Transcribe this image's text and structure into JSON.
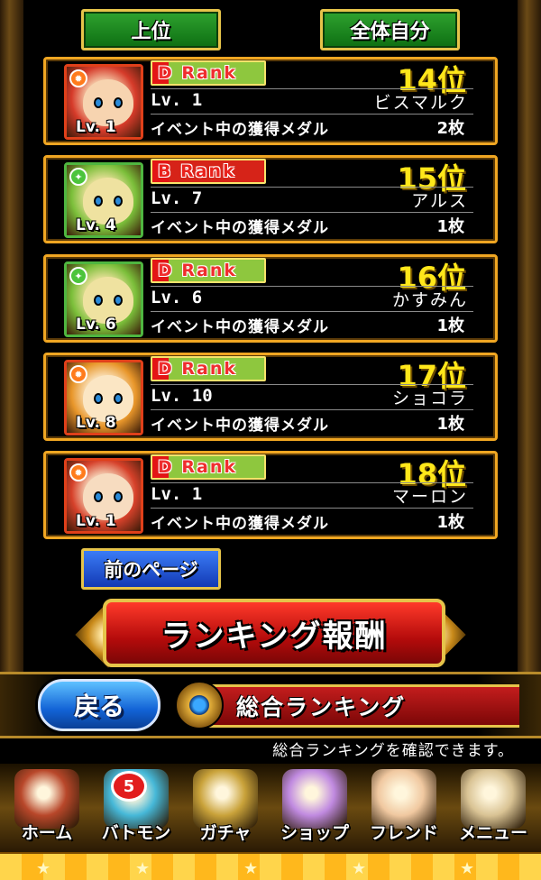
{
  "top_buttons": {
    "top": "上位",
    "self": "全体自分"
  },
  "entries": [
    {
      "rank_badge": "D Rank",
      "rank_class": "D",
      "place": "14位",
      "level": "Lv.  1",
      "name": "ビスマルク",
      "medal_label": "イベント中の獲得メダル",
      "medals": "2枚",
      "avatar_level": "Lv. 1",
      "element": "fire",
      "avatar_colors": [
        "#d63b2a",
        "#f7d4b0"
      ]
    },
    {
      "rank_badge": "B Rank",
      "rank_class": "B",
      "place": "15位",
      "level": "Lv.  7",
      "name": "アルス",
      "medal_label": "イベント中の獲得メダル",
      "medals": "1枚",
      "avatar_level": "Lv. 4",
      "element": "wind",
      "avatar_colors": [
        "#7bbf3a",
        "#efe2a0"
      ]
    },
    {
      "rank_badge": "D Rank",
      "rank_class": "D",
      "place": "16位",
      "level": "Lv.  6",
      "name": "かすみん",
      "medal_label": "イベント中の獲得メダル",
      "medals": "1枚",
      "avatar_level": "Lv. 6",
      "element": "wind",
      "avatar_colors": [
        "#7bbf3a",
        "#efe2a0"
      ]
    },
    {
      "rank_badge": "D Rank",
      "rank_class": "D",
      "place": "17位",
      "level": "Lv. 10",
      "name": "ショコラ",
      "medal_label": "イベント中の獲得メダル",
      "medals": "1枚",
      "avatar_level": "Lv. 8",
      "element": "fire",
      "avatar_colors": [
        "#e8962a",
        "#fbe6c4"
      ]
    },
    {
      "rank_badge": "D Rank",
      "rank_class": "D",
      "place": "18位",
      "level": "Lv.  1",
      "name": "マーロン",
      "medal_label": "イベント中の獲得メダル",
      "medals": "1枚",
      "avatar_level": "Lv. 1",
      "element": "fire",
      "avatar_colors": [
        "#d6412a",
        "#f7dcc0"
      ]
    }
  ],
  "prev_page": "前のページ",
  "reward_button": "ランキング報酬",
  "back_button": "戻る",
  "screen_title": "総合ランキング",
  "info_text": "総合ランキングを確認できます。",
  "menu": [
    {
      "label": "ホーム",
      "icon": "home-icon",
      "color": "#b8472a"
    },
    {
      "label": "バトモン",
      "icon": "monster-icon",
      "color": "#46b8d8",
      "badge": "5"
    },
    {
      "label": "ガチャ",
      "icon": "gacha-icon",
      "color": "#c9a23a"
    },
    {
      "label": "ショップ",
      "icon": "shop-icon",
      "color": "#c08ae0"
    },
    {
      "label": "フレンド",
      "icon": "friend-icon",
      "color": "#f0c8a0"
    },
    {
      "label": "メニュー",
      "icon": "scroll-icon",
      "color": "#d9c394"
    }
  ],
  "colors": {
    "accent_gold": "#f0a622",
    "place_yellow": "#ffe71a",
    "green_button": "#1b8a1f",
    "blue_button": "#2557d8",
    "red_button": "#c31d1d"
  }
}
